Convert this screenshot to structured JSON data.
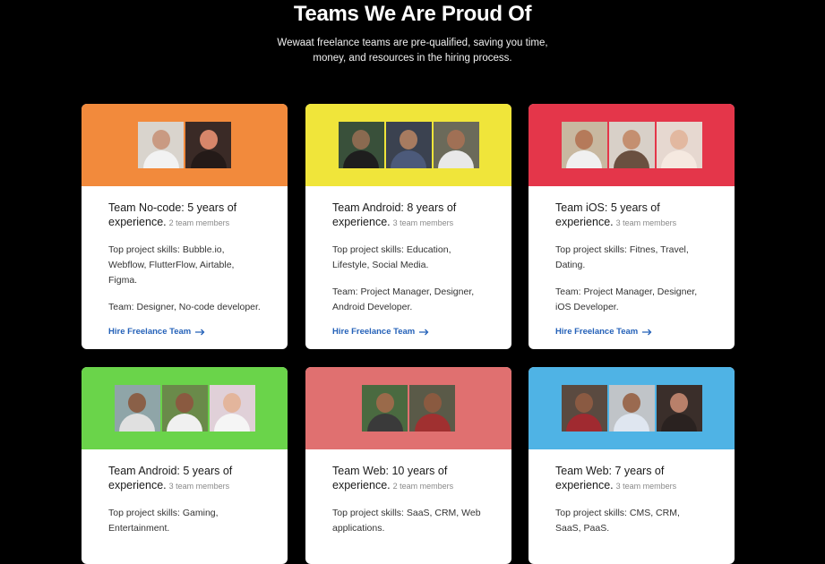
{
  "header": {
    "title": "Teams We Are Proud Of",
    "subtitle_line1": "Wewaat freelance teams are pre-qualified, saving you time,",
    "subtitle_line2": "money, and resources in the hiring process."
  },
  "hire_label": "Hire Freelance Team",
  "cards": [
    {
      "color": "#f28a3c",
      "title": "Team No-code: 5 years of experience.",
      "members": "2 team members",
      "skills": "Top project skills: Bubble.io, Webflow, FlutterFlow, Airtable, Figma.",
      "team": "Team: Designer, No-code developer."
    },
    {
      "color": "#f0e53a",
      "title": "Team Android: 8 years of experience.",
      "members": "3 team members",
      "skills": "Top project skills: Education, Lifestyle, Social Media.",
      "team": "Team: Project Manager, Designer, Android Developer."
    },
    {
      "color": "#e4364a",
      "title": "Team iOS: 5 years of experience.",
      "members": "3 team members",
      "skills": "Top project skills: Fitnes, Travel, Dating.",
      "team": "Team: Project Manager, Designer, iOS Developer."
    },
    {
      "color": "#6ad44a",
      "title": "Team Android: 5 years of experience.",
      "members": "3 team members",
      "skills": "Top project skills: Gaming, Entertainment.",
      "team": ""
    },
    {
      "color": "#e07070",
      "title": "Team Web: 10 years of experience.",
      "members": "2 team members",
      "skills": "Top project skills: SaaS, CRM, Web applications.",
      "team": ""
    },
    {
      "color": "#4fb3e5",
      "title": "Team Web: 7 years of experience.",
      "members": "3 team members",
      "skills": "Top project skills: CMS, CRM, SaaS, PaaS.",
      "team": ""
    }
  ]
}
